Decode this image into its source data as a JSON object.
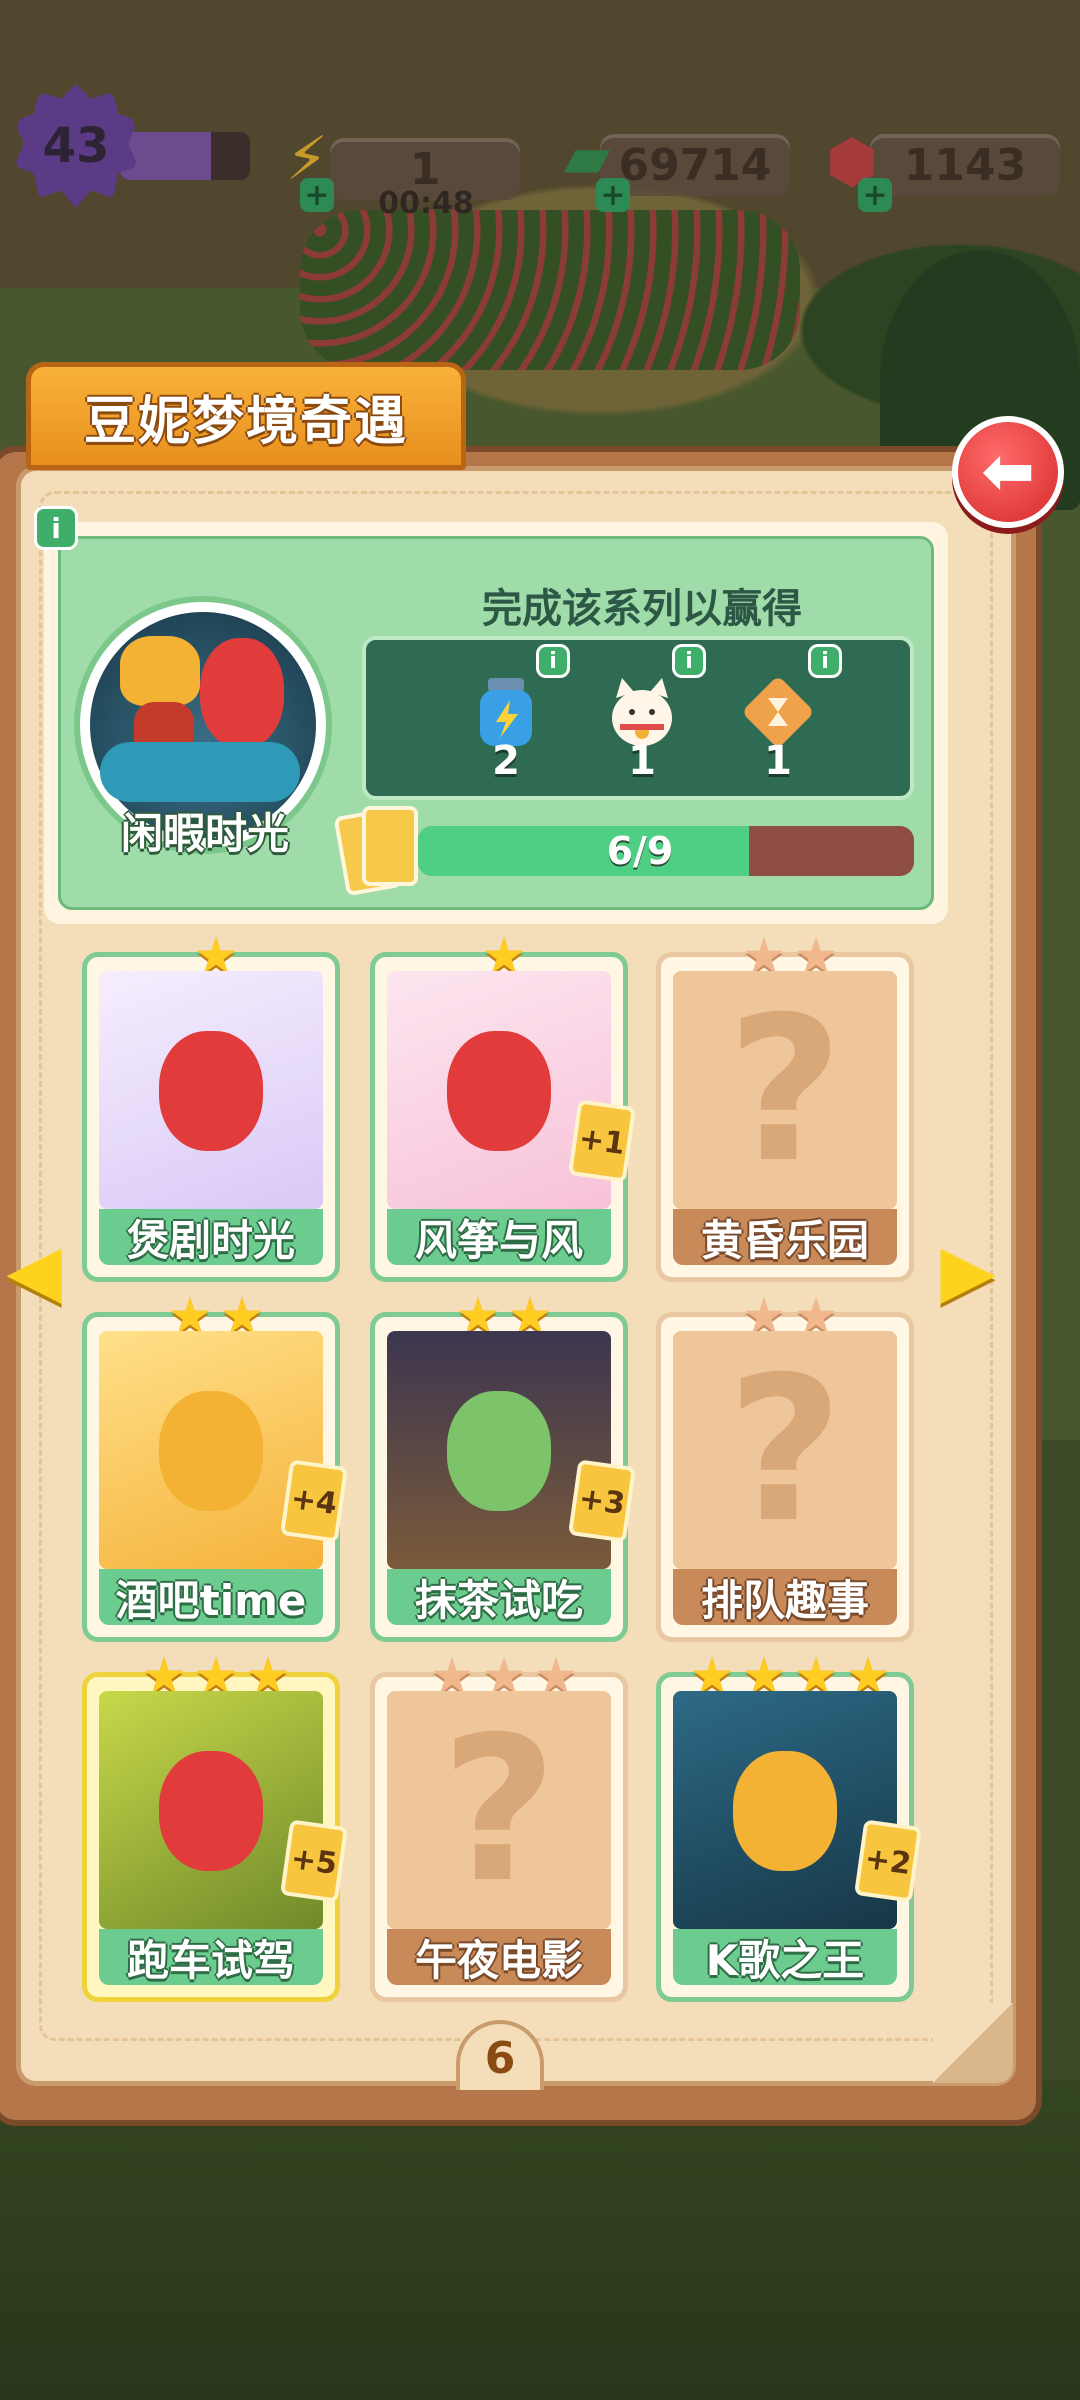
{
  "top_bar": {
    "level": "43",
    "energy": "1",
    "energy_timer": "00:48",
    "cash": "69714",
    "gems": "1143"
  },
  "album": {
    "title": "豆妮梦境奇遇",
    "back_icon": "back-arrow-icon",
    "set": {
      "name": "闲暇时光",
      "reward_title": "完成该系列以赢得",
      "rewards": [
        {
          "icon": "energy-bottle-icon",
          "count": "2"
        },
        {
          "icon": "lucky-cat-icon",
          "count": "1"
        },
        {
          "icon": "hourglass-icon",
          "count": "1"
        }
      ],
      "progress_text": "6/9",
      "progress_fraction": 0.667
    },
    "cards": [
      {
        "name": "煲剧时光",
        "stars": 1,
        "owned": true,
        "dup": ""
      },
      {
        "name": "风筝与风",
        "stars": 1,
        "owned": true,
        "dup": "+1"
      },
      {
        "name": "黄昏乐园",
        "stars": 2,
        "owned": false,
        "dup": ""
      },
      {
        "name": "酒吧time",
        "stars": 2,
        "owned": true,
        "dup": "+4"
      },
      {
        "name": "抹茶试吃",
        "stars": 2,
        "owned": true,
        "dup": "+3"
      },
      {
        "name": "排队趣事",
        "stars": 2,
        "owned": false,
        "dup": ""
      },
      {
        "name": "跑车试驾",
        "stars": 3,
        "owned": true,
        "dup": "+5"
      },
      {
        "name": "午夜电影",
        "stars": 3,
        "owned": false,
        "dup": ""
      },
      {
        "name": "K歌之王",
        "stars": 4,
        "owned": true,
        "dup": "+2"
      }
    ],
    "page_number": "6"
  },
  "colors": {
    "accent_green": "#6ccc8f",
    "tab_orange": "#f9b23a",
    "back_red": "#d62a2a",
    "star_gold": "#ffcc22"
  }
}
